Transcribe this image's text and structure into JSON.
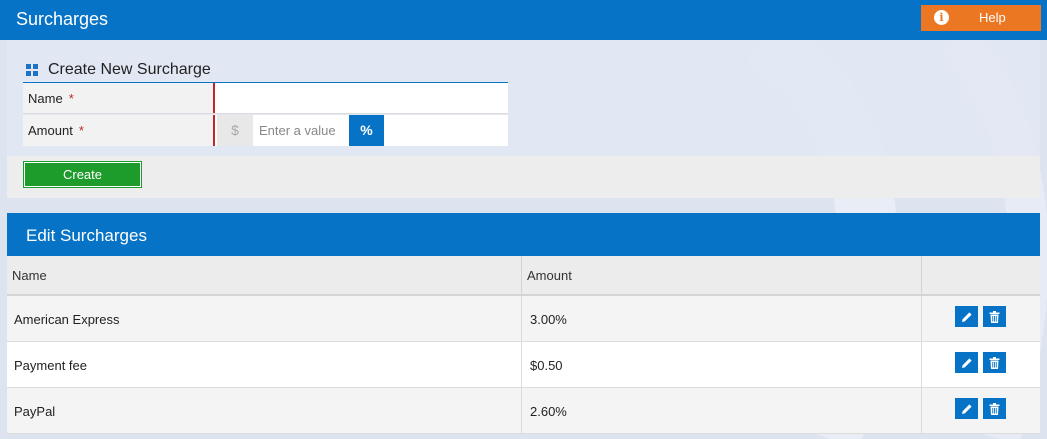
{
  "header": {
    "title": "Surcharges",
    "help_label": "Help"
  },
  "create": {
    "title": "Create New Surcharge",
    "name_label": "Name",
    "amount_label": "Amount",
    "required_mark": "*",
    "name_value": "",
    "amount_placeholder": "Enter a value",
    "dollar_symbol": "$",
    "percent_symbol": "%",
    "create_label": "Create"
  },
  "edit": {
    "title": "Edit Surcharges",
    "columns": [
      "Name",
      "Amount",
      ""
    ],
    "rows": [
      {
        "name": "American Express",
        "amount": "3.00%"
      },
      {
        "name": "Payment fee",
        "amount": "$0.50"
      },
      {
        "name": "PayPal",
        "amount": "2.60%"
      }
    ]
  },
  "colors": {
    "primary": "#0673c6",
    "help": "#ec7722",
    "create": "#1d9b2b",
    "required": "#c0262c"
  },
  "icons": {
    "help": "info-icon",
    "section": "grid-icon",
    "edit": "pencil-icon",
    "delete": "trash-icon"
  }
}
